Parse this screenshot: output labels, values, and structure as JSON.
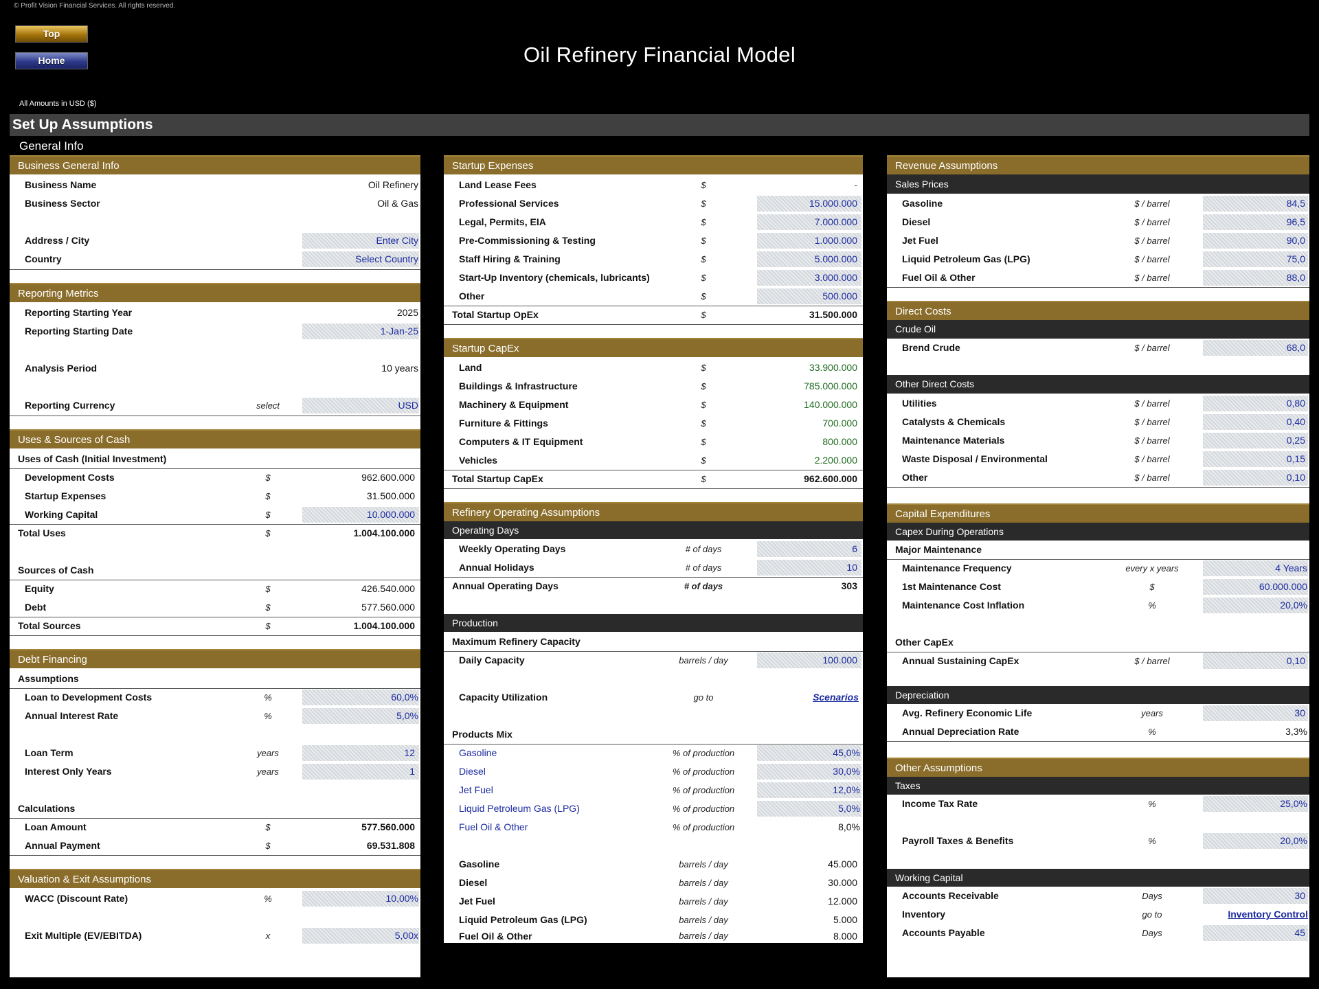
{
  "copyright": "© Profit Vision Financial Services. All rights reserved.",
  "nav": {
    "top": "Top",
    "home": "Home"
  },
  "title": "Oil Refinery Financial Model",
  "amounts_in": "All Amounts in  USD ($)",
  "setup": "Set Up Assumptions",
  "general": "General Info",
  "c1": {
    "bgi": "Business General Info",
    "business_name": "Business Name",
    "business_name_v": "Oil Refinery",
    "business_sector": "Business Sector",
    "business_sector_v": "Oil & Gas",
    "address": "Address / City",
    "address_v": "Enter City",
    "country": "Country",
    "country_v": "Select Country",
    "rm": "Reporting Metrics",
    "rsy": "Reporting Starting Year",
    "rsy_v": "2025",
    "rsd": "Reporting Starting Date",
    "rsd_v": "1-Jan-25",
    "ap": "Analysis Period",
    "ap_v": "10 years",
    "rc": "Reporting Currency",
    "rc_u": "select",
    "rc_v": "USD",
    "usc": "Uses & Sources of Cash",
    "uoc": "Uses of Cash (Initial Investment)",
    "dev": "Development Costs",
    "dev_v": "962.600.000",
    "se": "Startup Expenses",
    "se_v": "31.500.000",
    "wc": "Working Capital",
    "wc_v": "10.000.000",
    "tu": "Total Uses",
    "tu_v": "1.004.100.000",
    "soc": "Sources of Cash",
    "eq": "Equity",
    "eq_v": "426.540.000",
    "debt": "Debt",
    "debt_v": "577.560.000",
    "ts": "Total Sources",
    "ts_v": "1.004.100.000",
    "df": "Debt Financing",
    "assump": "Assumptions",
    "ltd": "Loan to Development Costs",
    "ltd_v": "60,0%",
    "air": "Annual Interest Rate",
    "air_v": "5,0%",
    "lt": "Loan Term",
    "lt_v": "12",
    "ioy": "Interest Only Years",
    "ioy_v": "1",
    "calc": "Calculations",
    "la": "Loan Amount",
    "la_v": "577.560.000",
    "apay": "Annual Payment",
    "apay_v": "69.531.808",
    "vea": "Valuation & Exit Assumptions",
    "wacc": "WACC (Discount Rate)",
    "wacc_v": "10,00%",
    "em": "Exit Multiple (EV/EBITDA)",
    "em_v": "5,00x",
    "u_dollar": "$",
    "u_pct": "%",
    "u_years": "years",
    "u_x": "x"
  },
  "c2": {
    "se": "Startup Expenses",
    "llf": "Land Lease Fees",
    "llf_v": "-",
    "ps": "Professional Services",
    "ps_v": "15.000.000",
    "lpe": "Legal, Permits, EIA",
    "lpe_v": "7.000.000",
    "pct": "Pre-Commissioning & Testing",
    "pct_v": "1.000.000",
    "sht": "Staff Hiring & Training",
    "sht_v": "5.000.000",
    "sui": "Start-Up Inventory (chemicals, lubricants)",
    "sui_v": "3.000.000",
    "oth": "Other",
    "oth_v": "500.000",
    "tso": "Total Startup OpEx",
    "tso_v": "31.500.000",
    "sc": "Startup CapEx",
    "land": "Land",
    "land_v": "33.900.000",
    "bi": "Buildings & Infrastructure",
    "bi_v": "785.000.000",
    "me": "Machinery & Equipment",
    "me_v": "140.000.000",
    "ff": "Furniture & Fittings",
    "ff_v": "700.000",
    "cit": "Computers & IT Equipment",
    "cit_v": "800.000",
    "veh": "Vehicles",
    "veh_v": "2.200.000",
    "tsc": "Total Startup CapEx",
    "tsc_v": "962.600.000",
    "roa": "Refinery Operating Assumptions",
    "od": "Operating Days",
    "wod": "Weekly Operating Days",
    "wod_v": "6",
    "ah": "Annual Holidays",
    "ah_v": "10",
    "aod": "Annual Operating Days",
    "aod_v": "303",
    "u_days": "# of days",
    "prod": "Production",
    "mrc": "Maximum Refinery Capacity",
    "dc": "Daily Capacity",
    "dc_u": "barrels / day",
    "dc_v": "100.000",
    "cu": "Capacity Utilization",
    "cu_u": "go to",
    "cu_v": "Scenarios",
    "pm": "Products Mix",
    "u_pop": "% of production",
    "gas": "Gasoline",
    "gas_v": "45,0%",
    "die": "Diesel",
    "die_v": "30,0%",
    "jet": "Jet Fuel",
    "jet_v": "12,0%",
    "lpg": "Liquid Petroleum Gas (LPG)",
    "lpg_v": "5,0%",
    "fuel": "Fuel Oil & Other",
    "fuel_v": "8,0%",
    "u_bpd": "barrels / day",
    "gas_b": "45.000",
    "die_b": "30.000",
    "jet_b": "12.000",
    "lpg_b": "5.000",
    "fuel_b": "8.000",
    "u_dollar": "$"
  },
  "c3": {
    "ra": "Revenue Assumptions",
    "sp": "Sales Prices",
    "u_bbl": "$ / barrel",
    "gas": "Gasoline",
    "gas_v": "84,5",
    "die": "Diesel",
    "die_v": "96,5",
    "jet": "Jet Fuel",
    "jet_v": "90,0",
    "lpg": "Liquid Petroleum Gas (LPG)",
    "lpg_v": "75,0",
    "fuel": "Fuel Oil & Other",
    "fuel_v": "88,0",
    "dc": "Direct Costs",
    "co": "Crude Oil",
    "brent": "Brend Crude",
    "brent_v": "68,0",
    "odc": "Other Direct Costs",
    "util": "Utilities",
    "util_v": "0,80",
    "cat": "Catalysts & Chemicals",
    "cat_v": "0,40",
    "mm": "Maintenance Materials",
    "mm_v": "0,25",
    "wde": "Waste Disposal / Environmental",
    "wde_v": "0,15",
    "oth": "Other",
    "oth_v": "0,10",
    "ce": "Capital Expenditures",
    "cdo": "Capex During Operations",
    "mjm": "Major Maintenance",
    "mf": "Maintenance Frequency",
    "mf_u": "every x years",
    "mf_v": "4 Years",
    "fmc": "1st Maintenance Cost",
    "fmc_v": "60.000.000",
    "mci": "Maintenance Cost Inflation",
    "mci_v": "20,0%",
    "oc": "Other CapEx",
    "asc": "Annual Sustaining CapEx",
    "asc_v": "0,10",
    "dep": "Depreciation",
    "arel": "Avg. Refinery Economic Life",
    "arel_v": "30",
    "adr": "Annual Depreciation Rate",
    "adr_v": "3,3%",
    "oa": "Other Assumptions",
    "tax": "Taxes",
    "itr": "Income Tax Rate",
    "itr_v": "25,0%",
    "ptb": "Payroll Taxes & Benefits",
    "ptb_v": "20,0%",
    "wcap": "Working Capital",
    "ar": "Accounts Receivable",
    "ar_v": "30",
    "inv": "Inventory",
    "inv_u": "go to",
    "inv_v": "Inventory Control",
    "apy": "Accounts Payable",
    "apy_v": "45",
    "u_dollar": "$",
    "u_pct": "%",
    "u_years": "years",
    "u_days": "Days"
  }
}
